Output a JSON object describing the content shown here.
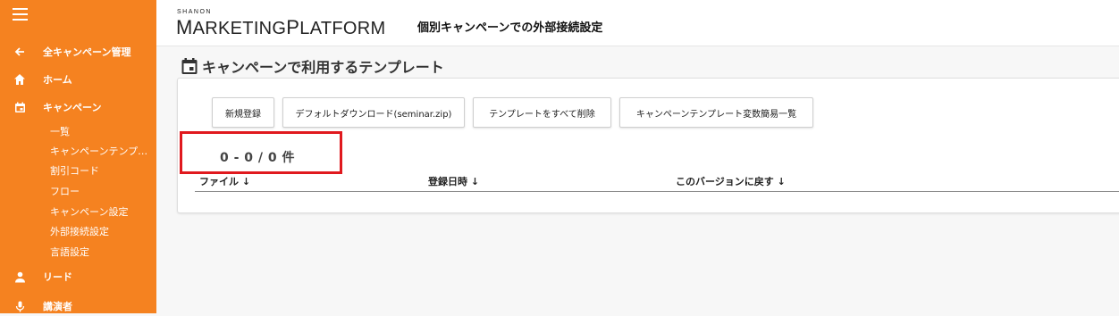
{
  "sidebar": {
    "back_label": "全キャンペーン管理",
    "home_label": "ホーム",
    "campaign_label": "キャンペーン",
    "sub_items": [
      "一覧",
      "キャンペーンテンプ…",
      "割引コード",
      "フロー",
      "キャンペーン設定",
      "外部接続設定",
      "言語設定"
    ],
    "lead_label": "リード",
    "speaker_label": "講演者"
  },
  "header": {
    "logo_top": "SHANON",
    "logo_m": "M",
    "logo_arketing": "ARKETING",
    "logo_p": "P",
    "logo_latform": "LATFORM",
    "page_title": "個別キャンペーンでの外部接続設定"
  },
  "section": {
    "title": "キャンペーンで利用するテンプレート"
  },
  "toolbar": {
    "new_label": "新規登録",
    "download_label": "デフォルトダウンロード(seminar.zip)",
    "delete_all_label": "テンプレートをすべて削除",
    "var_list_label": "キャンペーンテンプレート変数簡易一覧"
  },
  "pagination": {
    "count_text": "0 - 0 / 0 件"
  },
  "table": {
    "columns": [
      "ファイル ↓",
      "登録日時 ↓",
      "このバージョンに戻す ↓"
    ]
  },
  "colors": {
    "sidebar_bg": "#f58220",
    "highlight": "#e0191e"
  }
}
